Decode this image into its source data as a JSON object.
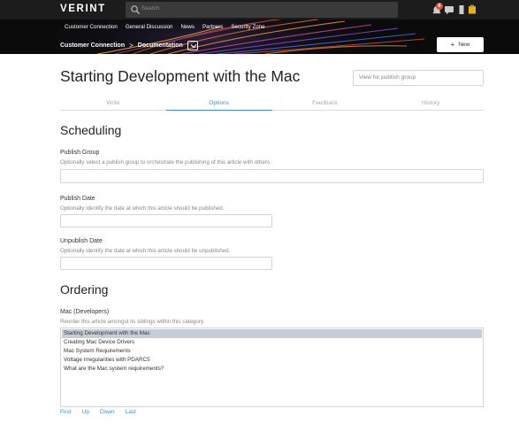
{
  "header": {
    "logo": "VERINT",
    "search_placeholder": "Search",
    "notification_count": "6",
    "icons": [
      "search-icon",
      "notification-bell-icon",
      "messages-icon",
      "bookmark-icon",
      "user-avatar-icon"
    ]
  },
  "nav": {
    "links": [
      "Customer Connection",
      "General Discussion",
      "News",
      "Partners",
      "Security Zone"
    ]
  },
  "breadcrumb": {
    "items": [
      "Customer Connection",
      "Documentation"
    ],
    "separator": ">"
  },
  "new_button": {
    "label": "New",
    "icon": "plus-icon"
  },
  "page": {
    "title": "Starting Development with the Mac",
    "publish_group_view": "View for publish group"
  },
  "tabs": [
    "Write",
    "Options",
    "Feedback",
    "History"
  ],
  "active_tab": "Options",
  "scheduling": {
    "heading": "Scheduling",
    "publish_group": {
      "label": "Publish Group",
      "hint": "Optionally select a publish group to orchestrate the publishing of this article with others.",
      "value": ""
    },
    "publish_date": {
      "label": "Publish Date",
      "hint": "Optionally identify the date at which this article should be published.",
      "value": ""
    },
    "unpublish_date": {
      "label": "Unpublish Date",
      "hint": "Optionally identify the date at which this article should be unpublished.",
      "value": ""
    }
  },
  "ordering": {
    "heading": "Ordering",
    "category_label": "Mac (Developers)",
    "hint": "Reorder this article amongst its siblings within this category.",
    "items": [
      "Starting Development with the Mac",
      "Creating Mac Device Drivers",
      "Mac System Requirements",
      "Voltage Irregularities with PDARC5",
      "What are the Mac system requirements?"
    ],
    "selected_item": "Starting Development with the Mac",
    "actions": [
      "First",
      "Up",
      "Down",
      "Last"
    ]
  },
  "colors": {
    "topbar": "#1c1c1c",
    "hero": "#0b0b0c",
    "accent": "#3f8fd0",
    "selected_row": "#c5ced6",
    "badge": "#d9553b"
  }
}
